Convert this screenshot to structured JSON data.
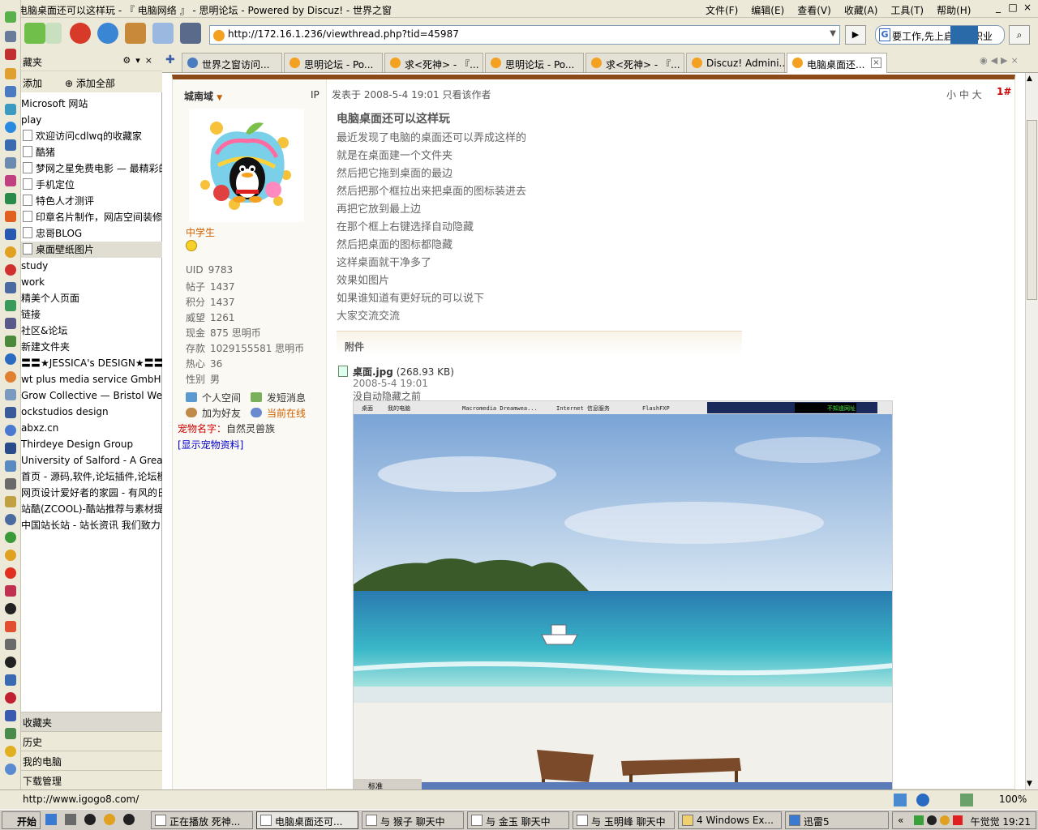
{
  "window": {
    "title": "电脑桌面还可以这样玩 - 『 电脑网络 』 - 思明论坛 - Powered by Discuz! - 世界之窗",
    "menus": [
      "文件(F)",
      "编辑(E)",
      "查看(V)",
      "收藏(A)",
      "工具(T)",
      "帮助(H)"
    ]
  },
  "address_bar": {
    "url": "http://172.16.1.236/viewthread.php?tid=45987"
  },
  "search_box": {
    "value": "要工作,先上启航求职业"
  },
  "sidebar": {
    "header": "藏夹",
    "add_label": "添加",
    "add_all_label": "添加全部",
    "items": [
      {
        "label": "Microsoft 网站",
        "sub": false
      },
      {
        "label": "play",
        "sub": false
      },
      {
        "label": "欢迎访问cdlwq的收藏家",
        "sub": true
      },
      {
        "label": "酷猪",
        "sub": true
      },
      {
        "label": "梦网之星免费电影 — 最精彩的",
        "sub": true
      },
      {
        "label": "手机定位",
        "sub": true
      },
      {
        "label": "特色人才测评",
        "sub": true
      },
      {
        "label": "印章名片制作，网店空间装修",
        "sub": true
      },
      {
        "label": "忠哥BLOG",
        "sub": true
      },
      {
        "label": "桌面壁纸图片",
        "sub": true,
        "selected": true
      },
      {
        "label": "study",
        "sub": false
      },
      {
        "label": "work",
        "sub": false
      },
      {
        "label": "精美个人页面",
        "sub": false
      },
      {
        "label": "链接",
        "sub": false
      },
      {
        "label": "社区&论坛",
        "sub": false
      },
      {
        "label": "新建文件夹",
        "sub": false
      },
      {
        "label": "〓〓★JESSICA's DESIGN★〓〓",
        "sub": false
      },
      {
        "label": "wt plus media service GmbH",
        "sub": false
      },
      {
        "label": "Grow Collective — Bristol Web D",
        "sub": false
      },
      {
        "label": "ockstudios design",
        "sub": false
      },
      {
        "label": "abxz.cn",
        "sub": false
      },
      {
        "label": "Thirdeye Design Group",
        "sub": false
      },
      {
        "label": "University of Salford - A Greater",
        "sub": false
      },
      {
        "label": "首页 - 源码,软件,论坛插件,论坛模",
        "sub": false
      },
      {
        "label": "网页设计爱好者的家园 - 有风的日",
        "sub": false
      },
      {
        "label": "站酷(ZCOOL)-酷站推荐与素材提供",
        "sub": false
      },
      {
        "label": "中国站长站 - 站长资讯  我们致力",
        "sub": false
      }
    ],
    "bottom_tabs": [
      "收藏夹",
      "历史",
      "我的电脑",
      "下载管理"
    ]
  },
  "tabs": [
    {
      "label": "世界之窗访问...",
      "active": false
    },
    {
      "label": "思明论坛 - Po...",
      "active": false
    },
    {
      "label": "求<死神> - 『...",
      "active": false
    },
    {
      "label": "思明论坛 - Po...",
      "active": false
    },
    {
      "label": "求<死神> - 『...",
      "active": false
    },
    {
      "label": "Discuz! Admini...",
      "active": false
    },
    {
      "label": "电脑桌面还...",
      "active": true
    }
  ],
  "post": {
    "author": "城南域",
    "ip_label": "IP",
    "rank": "中学生",
    "stats": [
      {
        "label": "UID",
        "value": "9783"
      },
      {
        "label": "帖子",
        "value": "1437"
      },
      {
        "label": "积分",
        "value": "1437"
      },
      {
        "label": "威望",
        "value": "1261"
      },
      {
        "label": "现金",
        "value": "875 思明币"
      },
      {
        "label": "存款",
        "value": "1029155581 思明币"
      },
      {
        "label": "热心",
        "value": "36"
      },
      {
        "label": "性别",
        "value": "男"
      }
    ],
    "actions": {
      "space": "个人空间",
      "pm": "发短消息",
      "add_friend": "加为好友",
      "online": "当前在线"
    },
    "pet_label": "宠物名字：",
    "pet_name": "自然灵兽族",
    "pet_link": "[显示宠物资料]",
    "meta": "发表于  2008-5-4 19:01  只看该作者",
    "font_sizes": "小  中  大",
    "floor": "1#",
    "subject": "电脑桌面还可以这样玩",
    "body_lines": [
      "最近发现了电脑的桌面还可以弄成这样的",
      "就是在桌面建一个文件夹",
      "然后把它拖到桌面的最边",
      "然后把那个框拉出来把桌面的图标装进去",
      "再把它放到最上边",
      "在那个框上右键选择自动隐藏",
      "然后把桌面的图标都隐藏",
      "这样桌面就干净多了",
      "效果如图片",
      "如果谁知道有更好玩的可以说下",
      "大家交流交流"
    ],
    "attachment_header": "附件",
    "attachment": {
      "name": "桌面.jpg",
      "size": "(268.93 KB)",
      "date": "2008-5-4 19:01",
      "desc": "没自动隐藏之前"
    },
    "screenshot_taskbar": {
      "items": [
        "桌面",
        "我的电脑",
        "Macromedia Dreamwea...",
        "Internet 信息服务",
        "FlashFXP"
      ],
      "status": "不知道网址",
      "bottom_label": "标准"
    }
  },
  "status_bar": {
    "url": "http://www.igogo8.com/",
    "zoom": "100%"
  },
  "taskbar": {
    "start": "开始",
    "tasks": [
      {
        "label": "正在播放 死神...",
        "active": false
      },
      {
        "label": "电脑桌面还可...",
        "active": true
      },
      {
        "label": "与 猴子 聊天中",
        "active": false
      },
      {
        "label": "与 金玉 聊天中",
        "active": false
      },
      {
        "label": "与 玉明峰 聊天中",
        "active": false
      },
      {
        "label": "4 Windows Ex...",
        "active": false
      },
      {
        "label": "迅雷5",
        "active": false
      }
    ],
    "clock": "午觉觉 19:21"
  },
  "colors": {
    "accent": "#8b4a17",
    "rank": "#d06000",
    "floor": "#c00000",
    "link": "#0000cc"
  }
}
